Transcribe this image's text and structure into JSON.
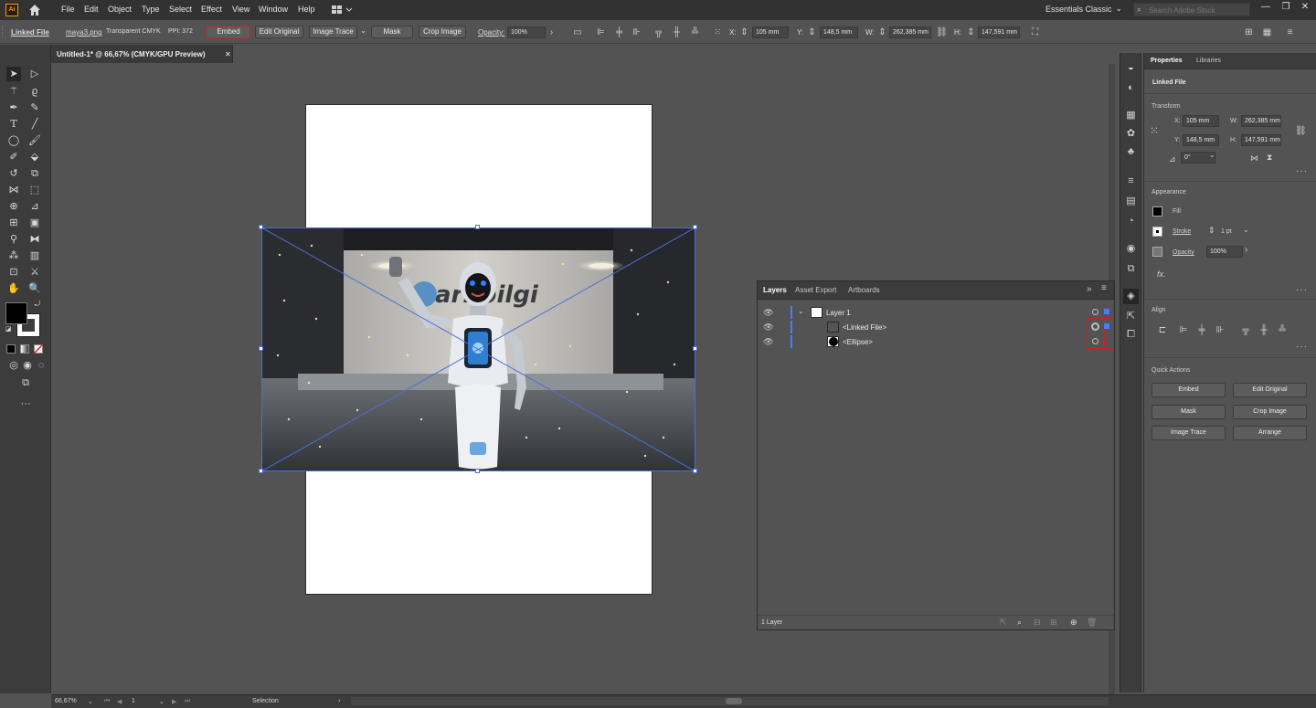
{
  "app": {
    "logo": "Ai"
  },
  "menu": [
    "File",
    "Edit",
    "Object",
    "Type",
    "Select",
    "Effect",
    "View",
    "Window",
    "Help"
  ],
  "workspace": {
    "label": "Essentials Classic"
  },
  "search": {
    "placeholder": "Search Adobe Stock"
  },
  "window_controls": {
    "minimize": "—",
    "restore": "❐",
    "close": "✕"
  },
  "controlbar": {
    "object_type": "Linked File",
    "filename": "maya3.png",
    "color_mode": "Transparent CMYK",
    "ppi": "PPI: 372",
    "embed": "Embed",
    "edit_original": "Edit Original",
    "image_trace": "Image Trace",
    "mask": "Mask",
    "crop_image": "Crop Image",
    "opacity_label": "Opacity:",
    "opacity": "100%",
    "x_label": "X:",
    "x": "105 mm",
    "y_label": "Y:",
    "y": "148,5 mm",
    "w_label": "W:",
    "w": "262,385 mm",
    "h_label": "H:",
    "h": "147,591 mm"
  },
  "document_tab": {
    "title": "Untitled-1* @ 66,67% (CMYK/GPU Preview)",
    "close": "✕"
  },
  "layers_panel": {
    "tabs": [
      "Layers",
      "Asset Export",
      "Artboards"
    ],
    "rows": [
      {
        "name": "Layer 1"
      },
      {
        "name": "<Linked File>"
      },
      {
        "name": "<Ellipse>"
      }
    ],
    "footer": "1 Layer"
  },
  "properties": {
    "tabs": [
      "Properties",
      "Libraries"
    ],
    "selection": "Linked File",
    "transform_title": "Transform",
    "x_label": "X:",
    "x": "105 mm",
    "y_label": "Y:",
    "y": "148,5 mm",
    "w_label": "W:",
    "w": "262,385 mm",
    "h_label": "H:",
    "h": "147,591 mm",
    "angle": "0°",
    "appearance_title": "Appearance",
    "fill": "Fill",
    "stroke": "Stroke",
    "stroke_weight": "1 pt",
    "opacity_label": "Opacity",
    "opacity": "100%",
    "fx": "fx.",
    "align_title": "Align",
    "quick_actions_title": "Quick Actions",
    "quick_actions": [
      "Embed",
      "Edit Original",
      "Mask",
      "Crop Image",
      "Image Trace",
      "Arrange"
    ]
  },
  "photo": {
    "sign_text": "arnbilgi"
  },
  "statusbar": {
    "zoom": "66,67%",
    "artboard": "1",
    "tool": "Selection"
  },
  "colors": {
    "accent": "#4a7bff",
    "highlight": "#d22020",
    "logo": "#ff9a00"
  }
}
